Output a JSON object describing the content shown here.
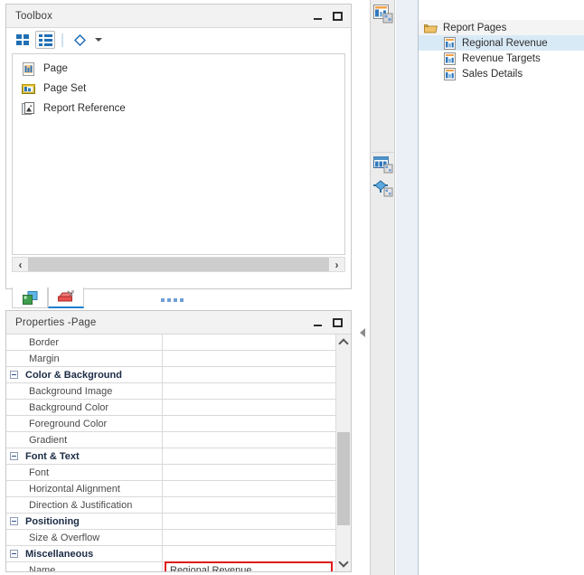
{
  "toolbox": {
    "title": "Toolbox",
    "minimize_label": "Minimize",
    "maximize_label": "Maximize",
    "toolbar": {
      "grid_view_label": "Grid View",
      "list_view_label": "List View",
      "filter_label": "Filter",
      "filter_dropdown_label": "Filter options"
    },
    "items": [
      {
        "label": "Page",
        "icon": "page-icon"
      },
      {
        "label": "Page Set",
        "icon": "page-set-icon"
      },
      {
        "label": "Report Reference",
        "icon": "report-reference-icon"
      }
    ],
    "scroll": {
      "left_arrow": "‹",
      "right_arrow": "›"
    },
    "tabs": [
      {
        "name": "toolbox-tab-objects",
        "selected": false
      },
      {
        "name": "toolbox-tab-palette",
        "selected": true
      }
    ]
  },
  "properties": {
    "title": "Properties -",
    "subject": "Page",
    "minimize_label": "Minimize",
    "maximize_label": "Maximize",
    "rows": [
      {
        "name": "Border",
        "value": "",
        "group": false,
        "expander": false,
        "highlight": false
      },
      {
        "name": "Margin",
        "value": "",
        "group": false,
        "expander": false,
        "highlight": false
      },
      {
        "name": "Color & Background",
        "value": "",
        "group": true,
        "expander": true,
        "highlight": false
      },
      {
        "name": "Background Image",
        "value": "",
        "group": false,
        "expander": false,
        "highlight": false
      },
      {
        "name": "Background Color",
        "value": "",
        "group": false,
        "expander": false,
        "highlight": false
      },
      {
        "name": "Foreground Color",
        "value": "",
        "group": false,
        "expander": false,
        "highlight": false
      },
      {
        "name": "Gradient",
        "value": "",
        "group": false,
        "expander": false,
        "highlight": false
      },
      {
        "name": "Font & Text",
        "value": "",
        "group": true,
        "expander": true,
        "highlight": false
      },
      {
        "name": "Font",
        "value": "",
        "group": false,
        "expander": false,
        "highlight": false
      },
      {
        "name": "Horizontal Alignment",
        "value": "",
        "group": false,
        "expander": false,
        "highlight": false
      },
      {
        "name": "Direction & Justification",
        "value": "",
        "group": false,
        "expander": false,
        "highlight": false
      },
      {
        "name": "Positioning",
        "value": "",
        "group": true,
        "expander": true,
        "highlight": false
      },
      {
        "name": "Size & Overflow",
        "value": "",
        "group": false,
        "expander": false,
        "highlight": false
      },
      {
        "name": "Miscellaneous",
        "value": "",
        "group": true,
        "expander": true,
        "highlight": false
      },
      {
        "name": "Name",
        "value": "Regional Revenue",
        "group": false,
        "expander": false,
        "highlight": true
      }
    ],
    "highlight_color": "#e01b1b"
  },
  "icon_strip": {
    "buttons": [
      {
        "name": "page-explorer-icon"
      },
      {
        "name": "query-explorer-icon"
      },
      {
        "name": "condition-explorer-icon"
      }
    ]
  },
  "tree": {
    "root": {
      "label": "Report Pages",
      "icon": "folder-icon"
    },
    "children": [
      {
        "label": "Regional Revenue",
        "icon": "page-icon",
        "selected": true
      },
      {
        "label": "Revenue Targets",
        "icon": "page-icon",
        "selected": false
      },
      {
        "label": "Sales Details",
        "icon": "page-icon",
        "selected": false
      }
    ],
    "selection_color": "#d9eaf7"
  },
  "splitter": {
    "collapse_label": "Collapse pane"
  }
}
